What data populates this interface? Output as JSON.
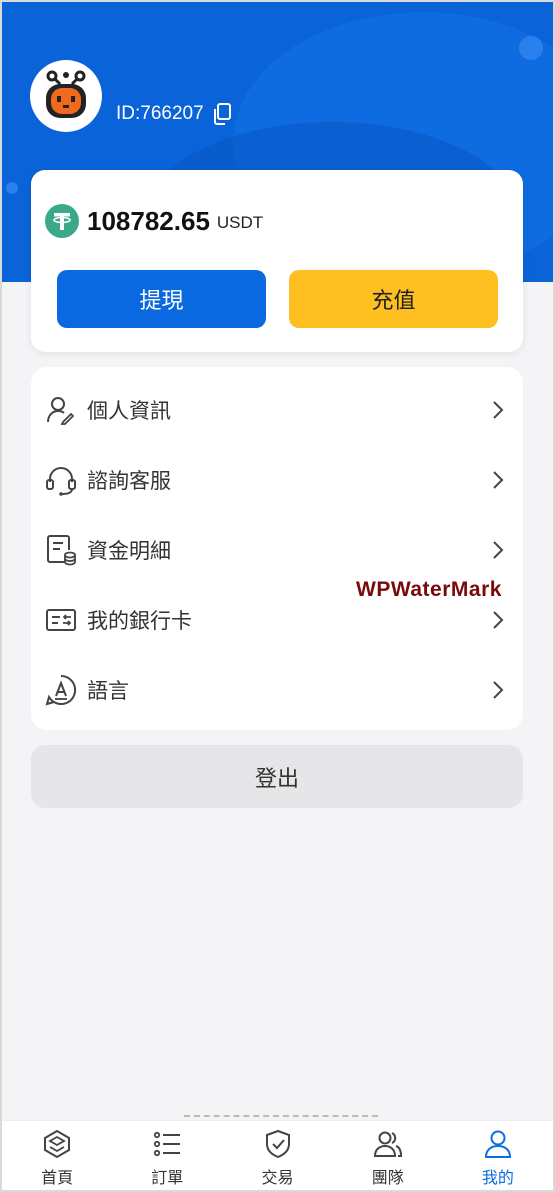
{
  "user": {
    "id_text": "ID:766207"
  },
  "balance": {
    "amount": "108782.65",
    "unit": "USDT"
  },
  "actions": {
    "withdraw_label": "提現",
    "deposit_label": "充值"
  },
  "menu": {
    "items": [
      {
        "label": "個人資訊",
        "icon": "user-edit-icon"
      },
      {
        "label": "諮詢客服",
        "icon": "headset-icon"
      },
      {
        "label": "資金明細",
        "icon": "ledger-icon"
      },
      {
        "label": "我的銀行卡",
        "icon": "bank-card-icon"
      },
      {
        "label": "語言",
        "icon": "language-icon"
      }
    ]
  },
  "watermark": "WPWaterMark",
  "logout_label": "登出",
  "nav": {
    "items": [
      {
        "label": "首頁",
        "icon": "home-icon"
      },
      {
        "label": "訂單",
        "icon": "list-icon"
      },
      {
        "label": "交易",
        "icon": "shield-check-icon"
      },
      {
        "label": "團隊",
        "icon": "team-icon"
      },
      {
        "label": "我的",
        "icon": "profile-icon",
        "active": true
      }
    ]
  },
  "colors": {
    "primary": "#0a69e0",
    "accent": "#fec020",
    "tether": "#3ba88a",
    "active_nav": "#0a6ee0"
  }
}
